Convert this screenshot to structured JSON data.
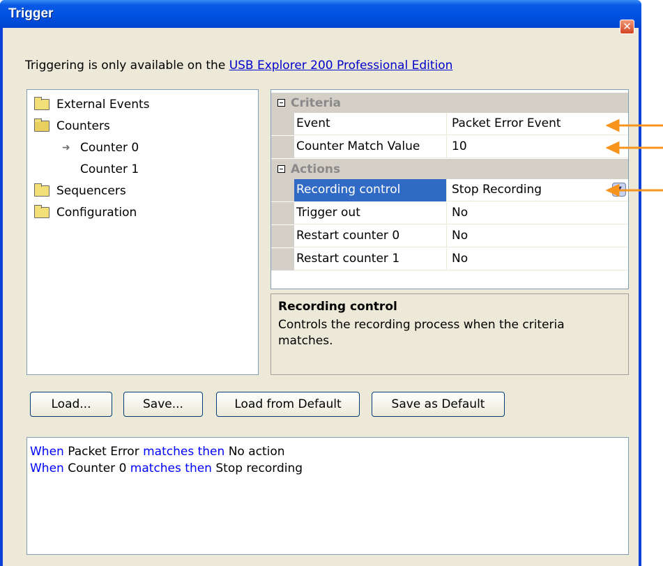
{
  "window": {
    "title": "Trigger",
    "close_glyph": "✕"
  },
  "notice": {
    "text": "Triggering is only available on the ",
    "link": "USB Explorer 200 Professional Edition"
  },
  "tree": {
    "items": [
      {
        "label": "External Events",
        "icon": "folder-closed-icon"
      },
      {
        "label": "Counters",
        "icon": "folder-open-icon"
      },
      {
        "label": "Counter 0",
        "icon": "arrow-right-icon"
      },
      {
        "label": "Counter 1",
        "icon": ""
      },
      {
        "label": "Sequencers",
        "icon": "folder-closed-icon"
      },
      {
        "label": "Configuration",
        "icon": "folder-closed-icon"
      }
    ]
  },
  "grid": {
    "categories": [
      {
        "name": "Criteria",
        "props": [
          {
            "name": "Event",
            "value": "Packet Error Event"
          },
          {
            "name": "Counter Match Value",
            "value": "10"
          }
        ]
      },
      {
        "name": "Actions",
        "props": [
          {
            "name": "Recording control",
            "value": "Stop Recording",
            "selected": true
          },
          {
            "name": "Trigger out",
            "value": "No"
          },
          {
            "name": "Restart counter 0",
            "value": "No"
          },
          {
            "name": "Restart counter 1",
            "value": "No"
          }
        ]
      }
    ]
  },
  "description": {
    "title": "Recording control",
    "text": "Controls the recording process when the criteria matches."
  },
  "buttons": {
    "load": "Load...",
    "save": "Save...",
    "load_default": "Load from Default",
    "save_default": "Save as Default"
  },
  "log": {
    "lines": [
      {
        "w1": "When",
        "subject": "Packet Error",
        "w2": "matches then",
        "action": "No action"
      },
      {
        "w1": "When",
        "subject": "Counter 0",
        "w2": "matches then",
        "action": "Stop recording"
      }
    ]
  },
  "colors": {
    "titlebar": "#0051e2",
    "face": "#ece9d8",
    "selection": "#316ac5",
    "keyword": "#0000ff",
    "callout_arrow": "#f7941d"
  }
}
